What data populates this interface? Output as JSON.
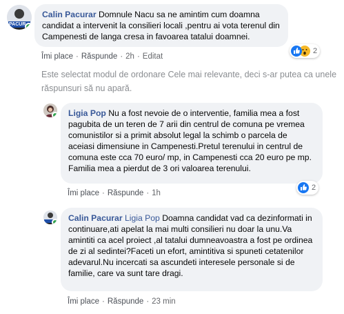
{
  "comments": [
    {
      "author": "Calin Pacurar",
      "text": "Domnule Nacu sa ne amintim cum doamna candidat a intervenit la consilieri locali ,pentru ai vota terenul din Campenesti de langa cresa in favoarea tatalui doamnei.",
      "like": "Îmi place",
      "reply": "Răspunde",
      "time": "2h",
      "edited": "Editat",
      "reaction_count": "2",
      "avatar_badge": "PACUR"
    },
    {
      "author": "Ligia Pop",
      "text": "Nu a fost nevoie de o interventie, familia mea a fost pagubita de un teren de 7 arii din centrul de comuna pe vremea comunistilor si a primit absolut legal la schimb o parcela de aceiasi dimensiune in Campenesti.Pretul terenului in centrul de comuna este cca 70 euro/ mp, in Campenesti cca 20 euro pe mp. Familia mea a pierdut de 3 ori valoarea terenului.",
      "like": "Îmi place",
      "reply": "Răspunde",
      "time": "1h",
      "reaction_count": "2"
    },
    {
      "author": "Calin Pacurar",
      "tag": "Ligia Pop",
      "text": "Doamna candidat vad ca dezinformati in continuare,ati apelat la mai multi consilieri nu doar la unu.Va amintiti ca acel proiect ,al tatalui dumneavoastra a fost pe ordinea de zi al sedintei?Faceti un efort, amintitiva si spuneti cetatenilor adevarul.Nu incercati sa ascundeti interesele personale si de familie, care va sunt tare dragi.",
      "like": "Îmi place",
      "reply": "Răspunde",
      "time": "23 min"
    }
  ],
  "notice": "Este selectat modul de ordonare Cele mai relevante, deci s-ar putea ca unele răspunsuri să nu apară.",
  "colors": {
    "author": "#385898",
    "bubble": "#f0f2f5",
    "like_blue": "#1877f2",
    "wow_yellow": "#f7b928",
    "online": "#31a24c"
  }
}
